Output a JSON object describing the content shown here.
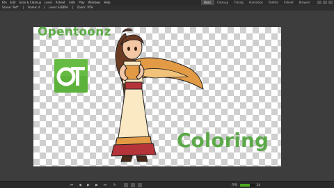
{
  "menubar": {
    "items": [
      "File",
      "Edit",
      "Scan & Cleanup",
      "Level",
      "Xsheet",
      "Cells",
      "Play",
      "Windows",
      "Help"
    ]
  },
  "rooms": [
    {
      "label": "Basic",
      "active": true
    },
    {
      "label": "Cleanup",
      "active": false
    },
    {
      "label": "Timing",
      "active": false
    },
    {
      "label": "Animation",
      "active": false
    },
    {
      "label": "Palette",
      "active": false
    },
    {
      "label": "Xsheet",
      "active": false
    },
    {
      "label": "Browser",
      "active": false
    }
  ],
  "viewer": {
    "scene": "Scene: Ted*",
    "frame": "Frame: 4",
    "level": "Level: ELBRIA",
    "zoom": "Zoom: 76%"
  },
  "canvas": {
    "title_text": "Opentoonz",
    "logo_text": "OT",
    "coloring_text": "Coloring",
    "title_color": "#5cab47",
    "checker_color": "#cfcfcf"
  },
  "playback": {
    "fps_label": "FPS:",
    "fps_value": "24",
    "fps_fraction": 0.64
  },
  "icons": [
    "first-frame-icon",
    "prev-frame-icon",
    "play-icon",
    "next-frame-icon",
    "last-frame-icon",
    "loop-icon",
    "camera-icon",
    "zoom-icon",
    "grid-icon"
  ]
}
